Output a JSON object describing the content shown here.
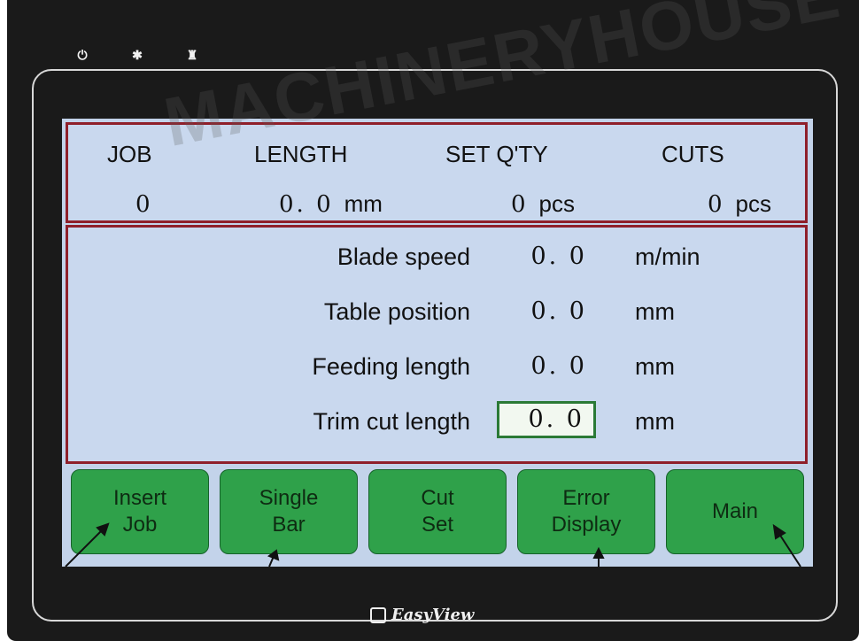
{
  "watermark": "MACHINERYHOUSE",
  "brand": "EasyView",
  "header": {
    "job_label": "JOB",
    "length_label": "LENGTH",
    "setqty_label": "SET Q'TY",
    "cuts_label": "CUTS",
    "job_value": "0",
    "length_value": "0. 0",
    "length_unit": "mm",
    "setqty_value": "0",
    "setqty_unit": "pcs",
    "cuts_value": "0",
    "cuts_unit": "pcs"
  },
  "params": [
    {
      "label": "Blade speed",
      "value": "0. 0",
      "unit": "m/min"
    },
    {
      "label": "Table position",
      "value": "0. 0",
      "unit": "mm"
    },
    {
      "label": "Feeding length",
      "value": "0. 0",
      "unit": "mm"
    },
    {
      "label": "Trim cut length",
      "value": "0. 0",
      "unit": "mm"
    }
  ],
  "buttons": {
    "insert_job": {
      "line1": "Insert",
      "line2": "Job"
    },
    "single_bar": {
      "line1": "Single",
      "line2": "Bar"
    },
    "cut_set": {
      "line1": "Cut",
      "line2": "Set"
    },
    "error_display": {
      "line1": "Error",
      "line2": "Display"
    },
    "main": {
      "line1": "Main"
    }
  },
  "icons": [
    "power-icon",
    "brightness-icon",
    "network-icon",
    "easyview-logo-icon"
  ],
  "colors": {
    "panel_border": "#8f1f2a",
    "button_green": "#2fa14a",
    "screen_bg": "#c3d3ea"
  }
}
